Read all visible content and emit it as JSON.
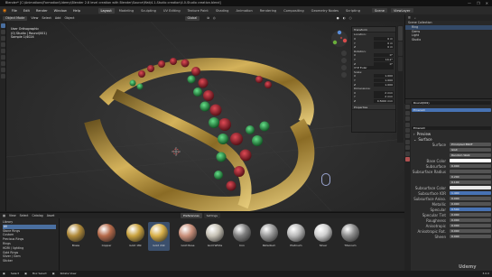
{
  "window": {
    "title": "Blender* [C:\\Animations\\Formation\\Udemy\\Blender 2.8 level creation with Blender\\Source\\Mat\\4.1-Studio creation\\4.0-Studio creation.blend]",
    "controls": [
      "—",
      "❐",
      "✕"
    ]
  },
  "menubar": {
    "items": [
      "File",
      "Edit",
      "Render",
      "Window",
      "Help"
    ],
    "workspaces": [
      "Layout",
      "Modeling",
      "Sculpting",
      "UV Editing",
      "Texture Paint",
      "Shading",
      "Animation",
      "Rendering",
      "Compositing",
      "Geometry Nodes",
      "Scripting"
    ],
    "active_workspace": "Layout",
    "scene_label": "Scene",
    "view_layer_label": "ViewLayer"
  },
  "viewport_header": {
    "mode": "Object Mode",
    "menus": [
      "View",
      "Select",
      "Add",
      "Object"
    ],
    "orientation": "Global"
  },
  "viewport_info": {
    "line1": "User Orthographic",
    "line2": "(0) Studio | Round(001)",
    "line3": "Sample 1/4024"
  },
  "npanel": {
    "transform_title": "Transform",
    "location_label": "Location:",
    "location": [
      "0 m",
      "0 m",
      "0 m"
    ],
    "rotation_label": "Rotation:",
    "rotation": [
      "0°",
      "14.2°",
      "0°"
    ],
    "mode_label": "XYZ Euler",
    "scale_label": "Scale:",
    "scale": [
      "1.000",
      "1.000",
      "1.000"
    ],
    "dimensions_label": "Dimensions:",
    "dimensions": [
      "2 mm",
      "2 mm",
      "0.5000 mm"
    ],
    "properties_label": "Properties",
    "axes": [
      "X",
      "Y",
      "Z"
    ]
  },
  "asset_browser": {
    "header_menus": [
      "View",
      "Select",
      "Catalog",
      "Asset"
    ],
    "tabs": [
      "Preferences",
      "Settings"
    ],
    "library_label": "Library",
    "categories": [
      "All",
      "Stone Rings",
      "Custom",
      "Precious Rings",
      "Rings",
      "HDRI / lighting",
      "Gold Rings",
      "Silver / Gem",
      "Sticker"
    ],
    "active_category": "All",
    "materials": [
      {
        "name": "Brass",
        "color": "#b08a3a"
      },
      {
        "name": "Copper",
        "color": "#b56a4a"
      },
      {
        "name": "Gold 18k",
        "color": "#c9a23f"
      },
      {
        "name": "Gold 24k",
        "color": "#d8b04a"
      },
      {
        "name": "Gold Rose",
        "color": "#c98f7a"
      },
      {
        "name": "Gold White",
        "color": "#c7c2b6"
      },
      {
        "name": "Iron",
        "color": "#7f7f7f"
      },
      {
        "name": "Palladium",
        "color": "#9a9a9a"
      },
      {
        "name": "Platinum",
        "color": "#b9b9b9"
      },
      {
        "name": "Silver",
        "color": "#cfcfcf"
      },
      {
        "name": "Titanium",
        "color": "#8e8e8e"
      }
    ],
    "selected_material": "Gold 24k"
  },
  "outliner": {
    "header": "Scene Collection",
    "rows": [
      "Scene Collection",
      "Ring",
      "Gems",
      "Light",
      "Studio"
    ],
    "selected_row": "Ring"
  },
  "properties": {
    "object_name": "Round(001)",
    "slot_label": "Emerald",
    "material_name": "Emerald",
    "preview_label": "Preview",
    "surface_label": "Surface",
    "surface_value": "Principled BSDF",
    "distribution": "GGX",
    "subsurface_method": "Random Walk",
    "fields": [
      {
        "label": "Base Color",
        "value": ""
      },
      {
        "label": "Subsurface",
        "value": "0.000"
      },
      {
        "label": "Subsurface Radius",
        "value": ""
      },
      {
        "label": "",
        "value": "0.200"
      },
      {
        "label": "",
        "value": "0.100"
      },
      {
        "label": "Subsurface Color",
        "value": ""
      },
      {
        "label": "Subsurface IOR",
        "value": "1.400"
      },
      {
        "label": "Subsurface Aniso.",
        "value": "0.000"
      },
      {
        "label": "Metallic",
        "value": "0.000"
      },
      {
        "label": "Specular",
        "value": "0.500"
      },
      {
        "label": "Specular Tint",
        "value": "0.000"
      },
      {
        "label": "Roughness",
        "value": "0.000"
      },
      {
        "label": "Anisotropic",
        "value": "0.000"
      },
      {
        "label": "Anisotropic Rot.",
        "value": "0.000"
      },
      {
        "label": "Sheen",
        "value": "0.000"
      }
    ]
  },
  "statusbar": {
    "left": "Select",
    "mid": "Box Select",
    "right": "Rotate View",
    "version": "3.0.0"
  },
  "colors": {
    "accent": "#4772b3",
    "gold": "#b8963a",
    "ruby": "#7a1620",
    "emerald": "#1f8a3a"
  },
  "watermark": "Udemy"
}
